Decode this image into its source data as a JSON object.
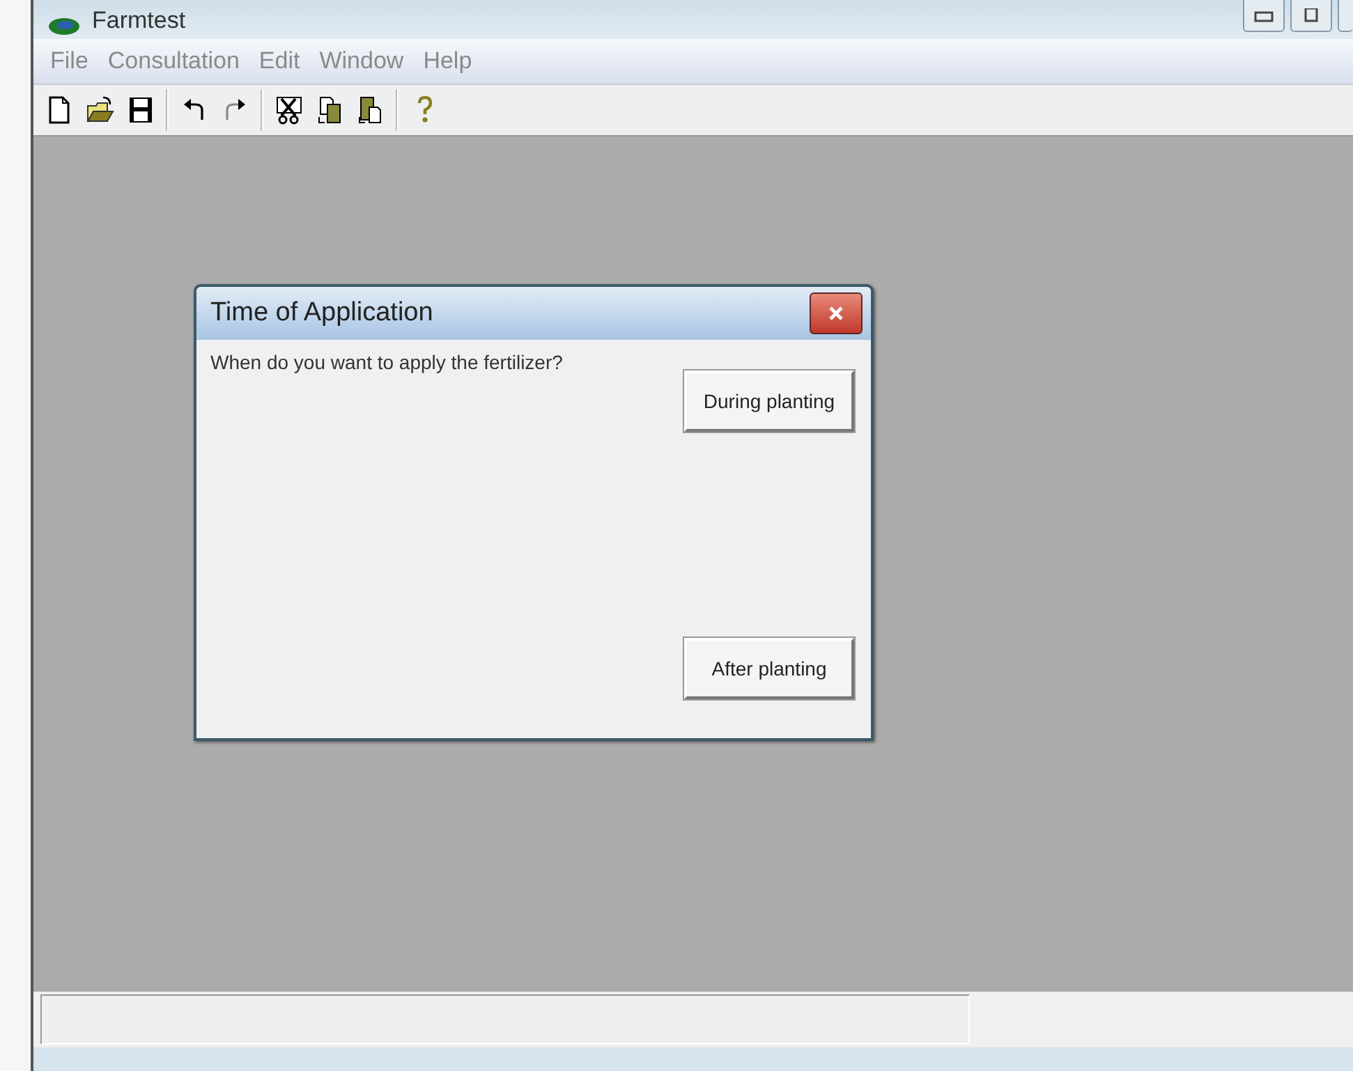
{
  "window": {
    "title": "Farmtest"
  },
  "menu": [
    "File",
    "Consultation",
    "Edit",
    "Window",
    "Help"
  ],
  "toolbar": [
    {
      "kind": "new"
    },
    {
      "kind": "open"
    },
    {
      "kind": "save"
    },
    {
      "kind": "sep"
    },
    {
      "kind": "undo"
    },
    {
      "kind": "redo"
    },
    {
      "kind": "sep"
    },
    {
      "kind": "cut"
    },
    {
      "kind": "copy"
    },
    {
      "kind": "paste"
    },
    {
      "kind": "sep"
    },
    {
      "kind": "help"
    }
  ],
  "dialog": {
    "title": "Time of Application",
    "question": "When do you want to apply the fertilizer?",
    "buttons": [
      "During planting",
      "After planting"
    ]
  }
}
